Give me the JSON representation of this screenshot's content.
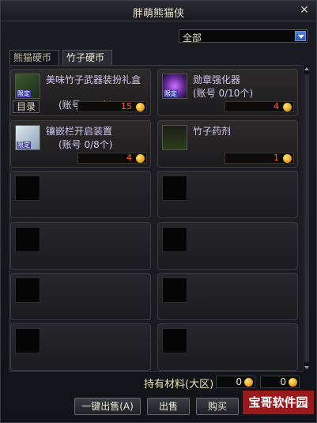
{
  "window": {
    "title": "胖萌熊猫侠",
    "close_label": "✕"
  },
  "filter": {
    "selected": "全部"
  },
  "tabs": [
    {
      "label": "熊猫硬币",
      "active": false
    },
    {
      "label": "竹子硬币",
      "active": true
    }
  ],
  "catalog_button": "目录",
  "items": [
    {
      "name": "美味竹子武器装扮礼盒",
      "limit": "(账号 0/1个)",
      "price": "15",
      "badge": "限定",
      "icon": "gift-box-icon"
    },
    {
      "name": "勋章强化器",
      "limit": "(账号 0/10个)",
      "price": "4",
      "badge": "限定",
      "icon": "medal-enhancer-icon"
    },
    {
      "name": "镶嵌栏开启装置",
      "limit": "(账号 0/8个)",
      "price": "4",
      "badge": "限定",
      "icon": "socket-opener-icon"
    },
    {
      "name": "竹子药剂",
      "limit": "",
      "price": "1",
      "badge": "",
      "icon": "bamboo-potion-icon"
    }
  ],
  "materials": {
    "label": "持有材料(大区)",
    "value1": "0",
    "value2": "0"
  },
  "buttons": {
    "sell_all": "一键出售(A)",
    "sell": "出售",
    "buy": "购买"
  },
  "watermark": "宝哥软件园"
}
